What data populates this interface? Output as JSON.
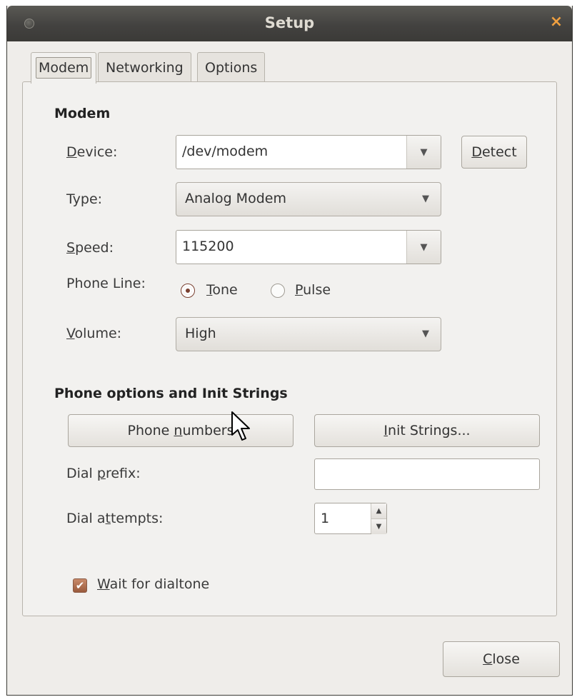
{
  "window": {
    "title": "Setup",
    "close_icon": "×"
  },
  "tabs": [
    "Modem",
    "Networking",
    "Options"
  ],
  "modem_section": {
    "title": "Modem",
    "device": {
      "label_u": "D",
      "label_rest": "evice:",
      "value": "/dev/modem",
      "detect_u": "D",
      "detect_rest": "etect"
    },
    "type": {
      "label": "Type:",
      "value": "Analog Modem"
    },
    "speed": {
      "label_u": "S",
      "label_rest": "peed:",
      "value": "115200"
    },
    "phone_line": {
      "label": "Phone Line:",
      "tone_u": "T",
      "tone_rest": "one",
      "pulse_u": "P",
      "pulse_rest": "ulse",
      "selected": "Tone"
    },
    "volume": {
      "label_u": "V",
      "label_rest": "olume:",
      "value": "High"
    }
  },
  "phone_section": {
    "title": "Phone options and Init Strings",
    "phone_numbers_pre": "Phone ",
    "phone_numbers_u": "n",
    "phone_numbers_post": "umbers",
    "init_strings_u": "I",
    "init_strings_rest": "nit Strings...",
    "dial_prefix_pre": "Dial ",
    "dial_prefix_u": "p",
    "dial_prefix_post": "refix:",
    "dial_prefix_value": "",
    "dial_attempts_pre": "Dial a",
    "dial_attempts_u": "t",
    "dial_attempts_post": "tempts:",
    "dial_attempts_value": "1",
    "wait_u": "W",
    "wait_rest": "ait for dialtone",
    "wait_checked": true
  },
  "close_button": {
    "u": "C",
    "rest": "lose"
  },
  "colors": {
    "accent": "#7a4030",
    "titlebar": "#434240",
    "close_glyph": "#f0a040"
  }
}
